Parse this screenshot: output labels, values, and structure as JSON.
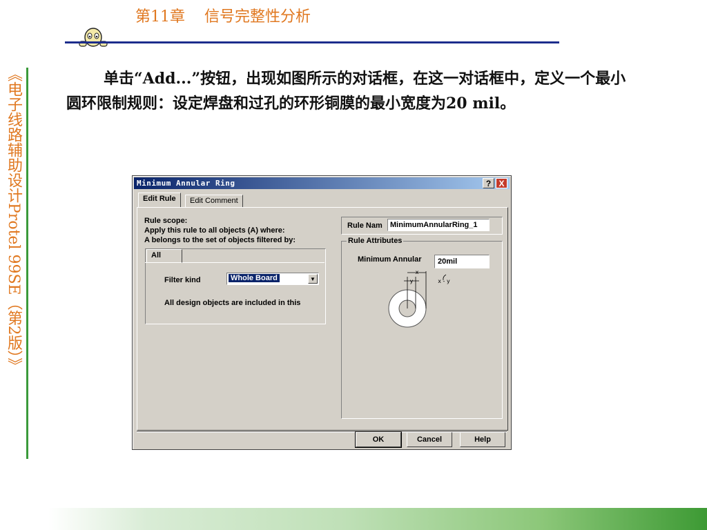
{
  "header": {
    "title": "第11章    信号完整性分析"
  },
  "side": {
    "title": "《电子线路辅助设计Protel 99SE（第2版）》"
  },
  "body": {
    "paragraph": "单击“Add...”按钮，出现如图所示的对话框，在这一对话框中，定义一个最小圆环限制规则：设定焊盘和过孔的环形铜膜的最小宽度为20 mil。"
  },
  "dialog": {
    "title": "Minimum Annular Ring",
    "help_button": "?",
    "close_button": "X",
    "tabs": [
      "Edit Rule",
      "Edit Comment"
    ],
    "scope": {
      "line1": "Rule scope:",
      "line2": "Apply this rule to all objects (A) where:",
      "line3": "A belongs to the set of objects filtered by:"
    },
    "filter": {
      "tab": "All",
      "kind_label": "Filter kind",
      "kind_value": "Whole Board",
      "description": "All design objects are included in this"
    },
    "rule_name": {
      "label": "Rule Nam",
      "value": "MinimumAnnularRing_1"
    },
    "attributes": {
      "title": "Rule Attributes",
      "min_label": "Minimum Annular",
      "min_value": "20mil",
      "diagram_x": "x",
      "diagram_y": "y",
      "diagram_formula": "x - y"
    },
    "buttons": {
      "ok": "OK",
      "cancel": "Cancel",
      "help": "Help"
    }
  }
}
